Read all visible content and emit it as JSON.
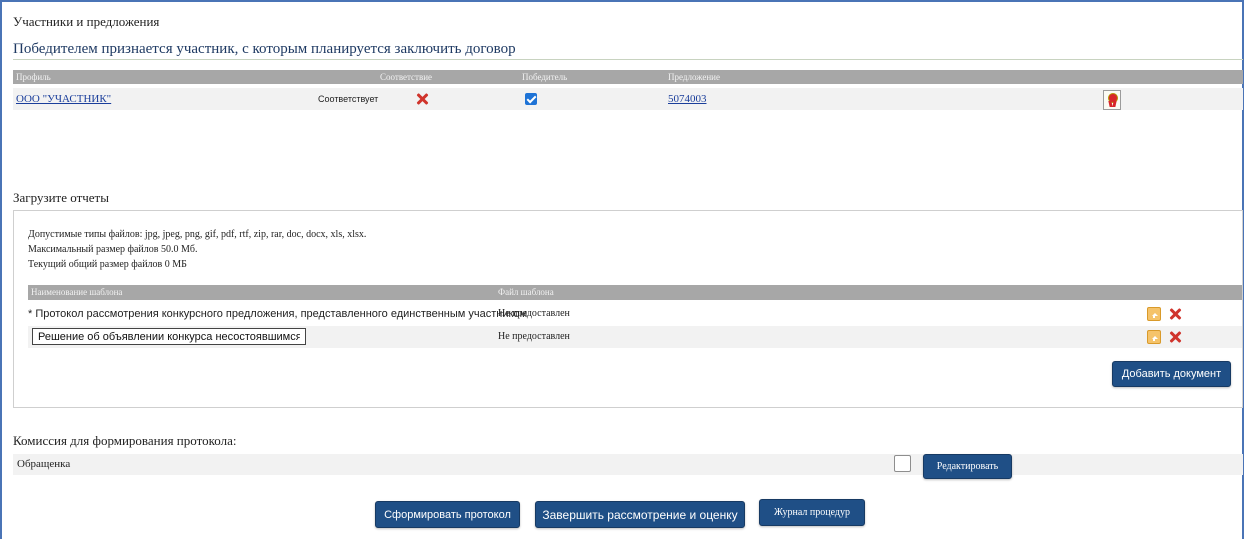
{
  "participants": {
    "section_title": "Участники и предложения",
    "winner_note": "Победителем признается участник, с которым планируется заключить договор",
    "columns": {
      "profile": "Профиль",
      "compliance": "Соответствие",
      "winner": "Победитель",
      "offer": "Предложение"
    },
    "rows": [
      {
        "name": "ООО \"УЧАСТНИК\"",
        "compliance_text": "Соответствует",
        "winner_checked": true,
        "offer": "5074003"
      }
    ]
  },
  "upload": {
    "title": "Загрузите отчеты",
    "allowed_types": "Допустимые типы файлов: jpg, jpeg, png, gif, pdf, rtf, zip, rar, doc, docx, xls, xlsx.",
    "max_size": "Максимальный размер файлов 50.0 Мб.",
    "current_size": "Текущий общий размер файлов  0 МБ",
    "columns": {
      "template_name": "Наименование шаблона",
      "template_file": "Файл шаблона"
    },
    "rows": [
      {
        "name": "* Протокол рассмотрения конкурсного предложения, представленного единственным участником",
        "status": "Не предоставлен",
        "editable": false
      },
      {
        "name": "Решение об объявлении конкурса несостоявшимся",
        "status": "Не предоставлен",
        "editable": true
      }
    ],
    "add_button": "Добавить документ"
  },
  "commission": {
    "title": "Комиссия для формирования протокола:",
    "member": "Обращенка",
    "edit_button": "Редактировать"
  },
  "actions": {
    "form_protocol": "Сформировать протокол",
    "finish_review": "Завершить рассмотрение и оценку",
    "procedure_log": "Журнал процедур"
  }
}
